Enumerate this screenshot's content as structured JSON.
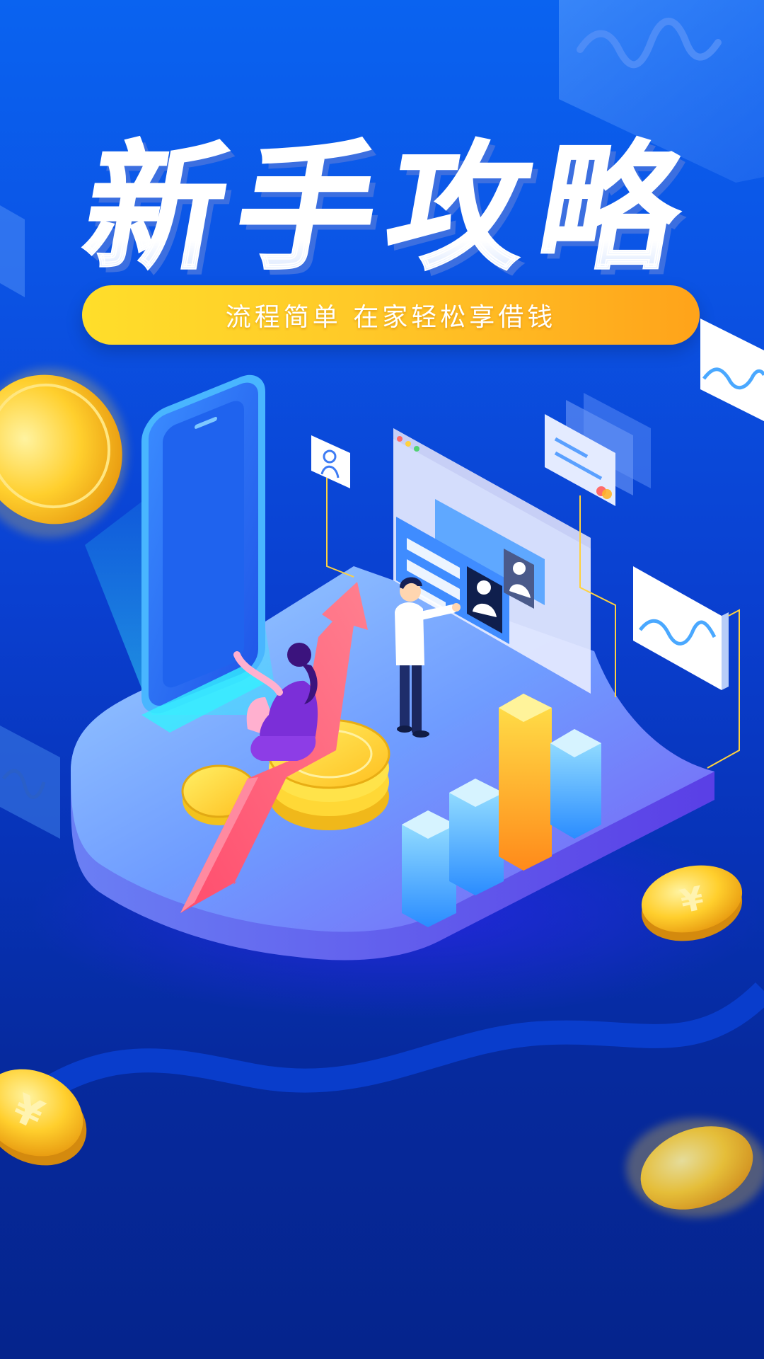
{
  "poster": {
    "title": "新手攻略",
    "subtitle": "流程简单 在家轻松享借钱"
  },
  "colors": {
    "background_top": "#0a63f0",
    "background_bottom": "#05248c",
    "banner_start": "#ffde2a",
    "banner_end": "#ffa31a",
    "arrow": "#ff5a79",
    "coin": "#ffcf2d"
  },
  "icons": [
    "phone-icon",
    "person-icon",
    "browser-window-icon",
    "wave-chart-icon",
    "coin-icon",
    "growth-arrow-icon",
    "bar-chart-icon"
  ]
}
